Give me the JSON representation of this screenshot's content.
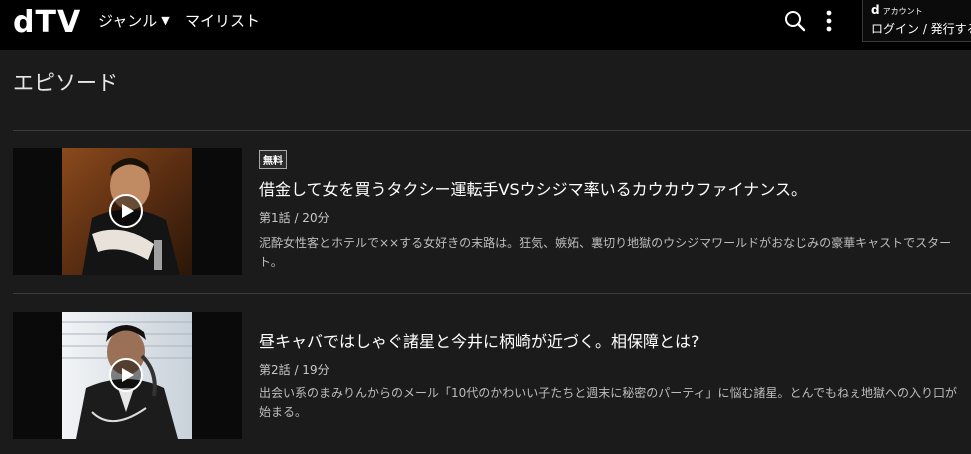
{
  "header": {
    "logo": "dTV",
    "nav_genre": "ジャンル",
    "nav_mylist": "マイリスト",
    "account_small_d": "d",
    "account_small": "アカウント",
    "account_main": "ログイン / 発行する"
  },
  "section": {
    "title": "エピソード"
  },
  "episodes": [
    {
      "badge": "無料",
      "title": "借金して女を買うタクシー運転手VSウシジマ率いるカウカウファイナンス。",
      "meta": "第1話 / 20分",
      "description": "泥酔女性客とホテルで××する女好きの末路は。狂気、嫉妬、裏切り地獄のウシジマワールドがおなじみの豪華キャストでスタート。"
    },
    {
      "title": "昼キャバではしゃぐ諸星と今井に柄崎が近づく。相保障とは?",
      "meta": "第2話 / 19分",
      "description": "出会い系のまみりんからのメール「10代のかわいい子たちと週末に秘密のパーティ」に悩む諸星。とんでもねぇ地獄への入り口が始まる。"
    }
  ]
}
